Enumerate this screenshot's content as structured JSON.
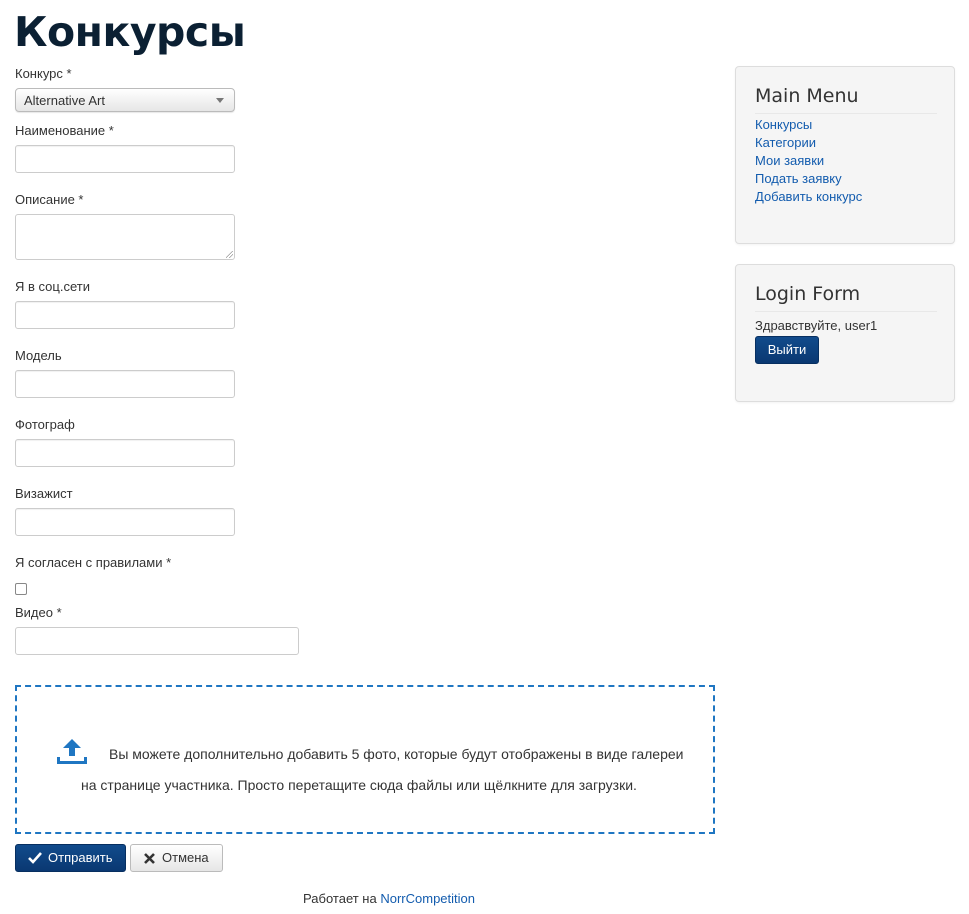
{
  "page": {
    "title": "Конкурсы"
  },
  "form": {
    "contest": {
      "label": "Конкурс *",
      "value": "Alternative Art"
    },
    "name": {
      "label": "Наименование *",
      "value": ""
    },
    "description": {
      "label": "Описание *",
      "value": ""
    },
    "social": {
      "label": "Я в соц.сети",
      "value": ""
    },
    "model": {
      "label": "Модель",
      "value": ""
    },
    "photographer": {
      "label": "Фотограф",
      "value": ""
    },
    "makeup": {
      "label": "Визажист",
      "value": ""
    },
    "agree": {
      "label": "Я согласен с правилами *",
      "checked": false
    },
    "video": {
      "label": "Видео *",
      "value": ""
    },
    "dropzone": {
      "text": "Вы можете дополнительно добавить 5 фото, которые будут отображены в виде галереи на странице участника. Просто перетащите сюда файлы или щёлкните для загрузки."
    },
    "submit_label": "Отправить",
    "cancel_label": "Отмена"
  },
  "footer": {
    "prefix": "Работает на",
    "link": "NorrCompetition"
  },
  "sidebar": {
    "main_menu": {
      "title": "Main Menu",
      "items": [
        {
          "label": "Конкурсы"
        },
        {
          "label": "Категории"
        },
        {
          "label": "Мои заявки"
        },
        {
          "label": "Подать заявку"
        },
        {
          "label": "Добавить конкурс"
        }
      ]
    },
    "login_form": {
      "title": "Login Form",
      "greeting": "Здравствуйте, user1",
      "logout_label": "Выйти"
    }
  },
  "colors": {
    "accent": "#0a3872",
    "link": "#135cae",
    "dropzone_border": "#1f76c2"
  },
  "icons": {
    "submit": "check-icon",
    "cancel": "close-icon",
    "upload": "upload-icon",
    "select": "chevron-down-icon"
  }
}
